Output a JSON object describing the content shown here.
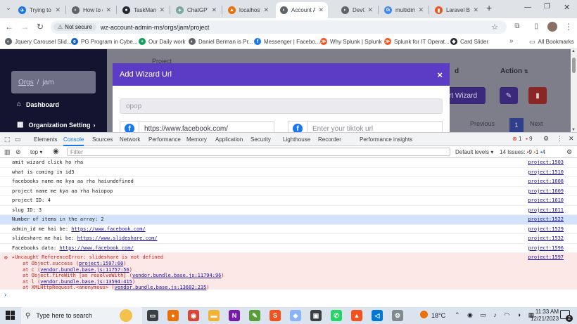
{
  "browser": {
    "tabs": [
      {
        "title": "Trying to",
        "color": "#1a73e8",
        "glyph": "✈"
      },
      {
        "title": "How to d",
        "color": "#5f6368",
        "glyph": "◐"
      },
      {
        "title": "TaskMan",
        "color": "#24292f",
        "glyph": "●"
      },
      {
        "title": "ChatGPT",
        "color": "#74aa9c",
        "glyph": "✦"
      },
      {
        "title": "localhost",
        "color": "#e8710a",
        "glyph": "▲"
      },
      {
        "title": "Account A",
        "color": "#5f6368",
        "glyph": "◐"
      },
      {
        "title": "DevOps F",
        "color": "#5f6368",
        "glyph": "◐"
      },
      {
        "title": "multidim",
        "color": "#4285f4",
        "glyph": "G"
      },
      {
        "title": "Laravel B",
        "color": "#f4511e",
        "glyph": "▮"
      }
    ],
    "address": {
      "security_label": "Not secure",
      "url": "wz-account-admin-ms/orgs/jam/project"
    },
    "bookmarks": [
      {
        "label": "Jquery Carousel Slid...",
        "color": "#5f6368",
        "glyph": "◐"
      },
      {
        "label": "PG Program in Cybe...",
        "color": "#1565c0",
        "glyph": "e"
      },
      {
        "label": "Our Daily work",
        "color": "#0f9d58",
        "glyph": "+"
      },
      {
        "label": "Daniel Berman is Pr...",
        "color": "#5f6368",
        "glyph": "◐"
      },
      {
        "label": "Messenger | Facebo...",
        "color": "#1877f2",
        "glyph": "f"
      },
      {
        "label": "Why Splunk | Splunk",
        "color": "#f4511e",
        "glyph": "≫"
      },
      {
        "label": "Splunk for IT Operat...",
        "color": "#f4511e",
        "glyph": "≫"
      },
      {
        "label": "Card Slider",
        "color": "#24292f",
        "glyph": "◆"
      }
    ],
    "all_bookmarks": "All Bookmarks"
  },
  "app": {
    "project_header": "Project",
    "breadcrumb_orgs": "Orgs",
    "breadcrumb_sep": "/",
    "breadcrumb_org": "jam",
    "nav": [
      {
        "label": "Dashboard",
        "icon": "home-icon"
      },
      {
        "label": "Organization Setting",
        "icon": "grid-icon"
      }
    ],
    "table_col_d": "d",
    "table_col_action": "Action",
    "wizard_button": "rt Wizard",
    "pagination": {
      "previous": "Previous",
      "current": "1",
      "next": "Next"
    }
  },
  "modal": {
    "title": "Add Wizard Url",
    "name_placeholder": "opop",
    "facebook_value": "https://www.facebook.com/",
    "tiktok_placeholder": "Enter your tiktok url"
  },
  "devtools": {
    "tabs": [
      "Elements",
      "Console",
      "Sources",
      "Network",
      "Performance",
      "Memory",
      "Application",
      "Security",
      "Lighthouse",
      "Recorder",
      "Performance insights"
    ],
    "active_tab": "Console",
    "error_count": "1",
    "warning_count": "9",
    "context": "top",
    "filter_placeholder": "Filter",
    "levels": "Default levels",
    "issues_label": "14 Issues:",
    "issues_err": "9",
    "issues_warn": "1",
    "issues_info": "4",
    "logs": [
      {
        "text": "amit wizard click ho rha",
        "src": "project:1503"
      },
      {
        "text": "what is coming in id3",
        "src": "project:1510"
      },
      {
        "text": "facebooks name me kya aa rha haiundefined",
        "src": "project:1608"
      },
      {
        "text": "project name me kya aa rha haiopop",
        "src": "project:1609"
      },
      {
        "text": "project ID: 4",
        "src": "project:1610"
      },
      {
        "text": "slug ID: 3",
        "src": "project:1611"
      },
      {
        "text": "Number of items in the array: 2",
        "src": "project:1522"
      },
      {
        "text": "admin_id me hai be: ",
        "link": "https://www.facebook.com/",
        "src": "project:1529"
      },
      {
        "text": "slideshare me hai be: ",
        "link": "https://www.slideshare.com/",
        "src": "project:1532"
      },
      {
        "text": "Facebooks data: ",
        "link": "https://www.facebook.com/",
        "src": "project:1596"
      }
    ],
    "error": {
      "message": "Uncaught ReferenceError: slideshare is not defined",
      "src": "project:1597",
      "stack": [
        {
          "prefix": "at Object.success (",
          "link": "project:1597:60",
          "suffix": ")"
        },
        {
          "prefix": "at c (",
          "link": "vendor.bundle.base.js:11757:56",
          "suffix": ")"
        },
        {
          "prefix": "at Object.fireWith [as resolveWith] (",
          "link": "vendor.bundle.base.js:11794:96",
          "suffix": ")"
        },
        {
          "prefix": "at l (",
          "link": "vendor.bundle.base.js:13594:415",
          "suffix": ")"
        },
        {
          "prefix": "at XMLHttpRequest.<anonymous> (",
          "link": "vendor.bundle.base.js:13682:235",
          "suffix": ")"
        }
      ]
    },
    "prompt": "›"
  },
  "taskbar": {
    "search_placeholder": "Type here to search",
    "weather": "18°C",
    "time": "11:33 AM",
    "date": "12/21/2023",
    "notification_count": "2"
  }
}
